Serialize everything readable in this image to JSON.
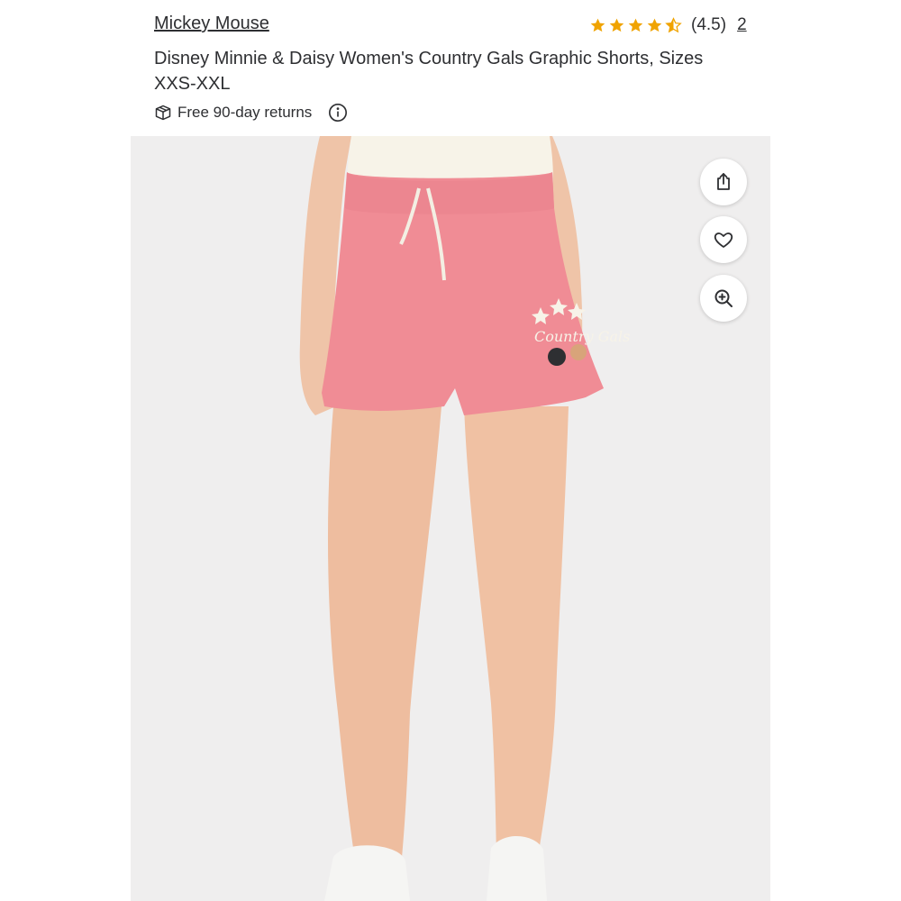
{
  "product": {
    "brand": "Mickey Mouse",
    "rating_text": "(4.5)",
    "rating_value": 4.5,
    "review_count": "2",
    "title": "Disney Minnie & Daisy Women's Country Gals Graphic Shorts, Sizes XXS-XXL",
    "returns_text": "Free 90-day returns",
    "graphic_text": "Country Gals"
  },
  "icons": {
    "star": "star-icon",
    "returns": "package-return-icon",
    "info": "info-icon",
    "share": "share-icon",
    "favorite": "heart-icon",
    "zoom": "zoom-in-icon"
  },
  "colors": {
    "star": "#f0a300",
    "text": "#2e2f32",
    "shorts": "#f08c95",
    "background": "#efeeee"
  }
}
